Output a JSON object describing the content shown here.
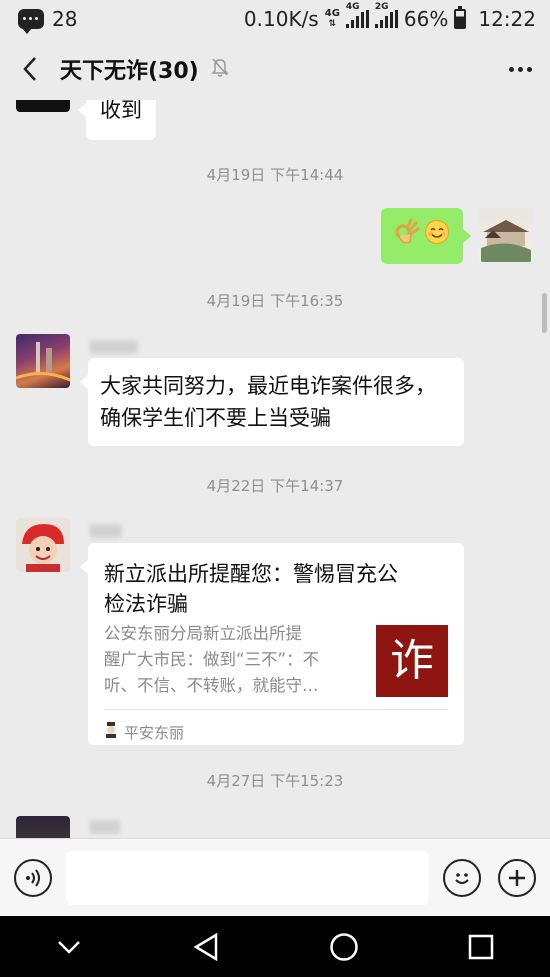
{
  "status": {
    "notif_count": "28",
    "speed": "0.10K/s",
    "net1": "4G",
    "net2": "4G",
    "net3": "2G",
    "battery": "66%",
    "time": "12:22"
  },
  "header": {
    "title": "天下无诈(30)",
    "back_icon": "chevron-left-icon",
    "mute_icon": "bell-off-icon",
    "more_icon": "more-dots-icon"
  },
  "chat": {
    "msg_received": "收到",
    "ts1": "4月19日 下午14:44",
    "ts2": "4月19日 下午16:35",
    "msg_effort_line1": "大家共同努力，最近电诈案件很多，",
    "msg_effort_line2": "确保学生们不要上当受骗",
    "ts3": "4月22日 下午14:37",
    "card": {
      "title_line1": "新立派出所提醒您：警惕冒充公",
      "title_line2": "检法诈骗",
      "desc_line1": "公安东丽分局新立派出所提",
      "desc_line2": "醒广大市民：做到“三不”：不",
      "desc_line3": "听、不信、不转账，就能守…",
      "thumb_char": "诈",
      "source": "平安东丽"
    },
    "ts4": "4月27日 下午15:23"
  },
  "input": {
    "placeholder": "",
    "value": ""
  },
  "colors": {
    "background": "#ebebeb",
    "bubble_self": "#95ec69",
    "thumb": "#8e1510"
  }
}
